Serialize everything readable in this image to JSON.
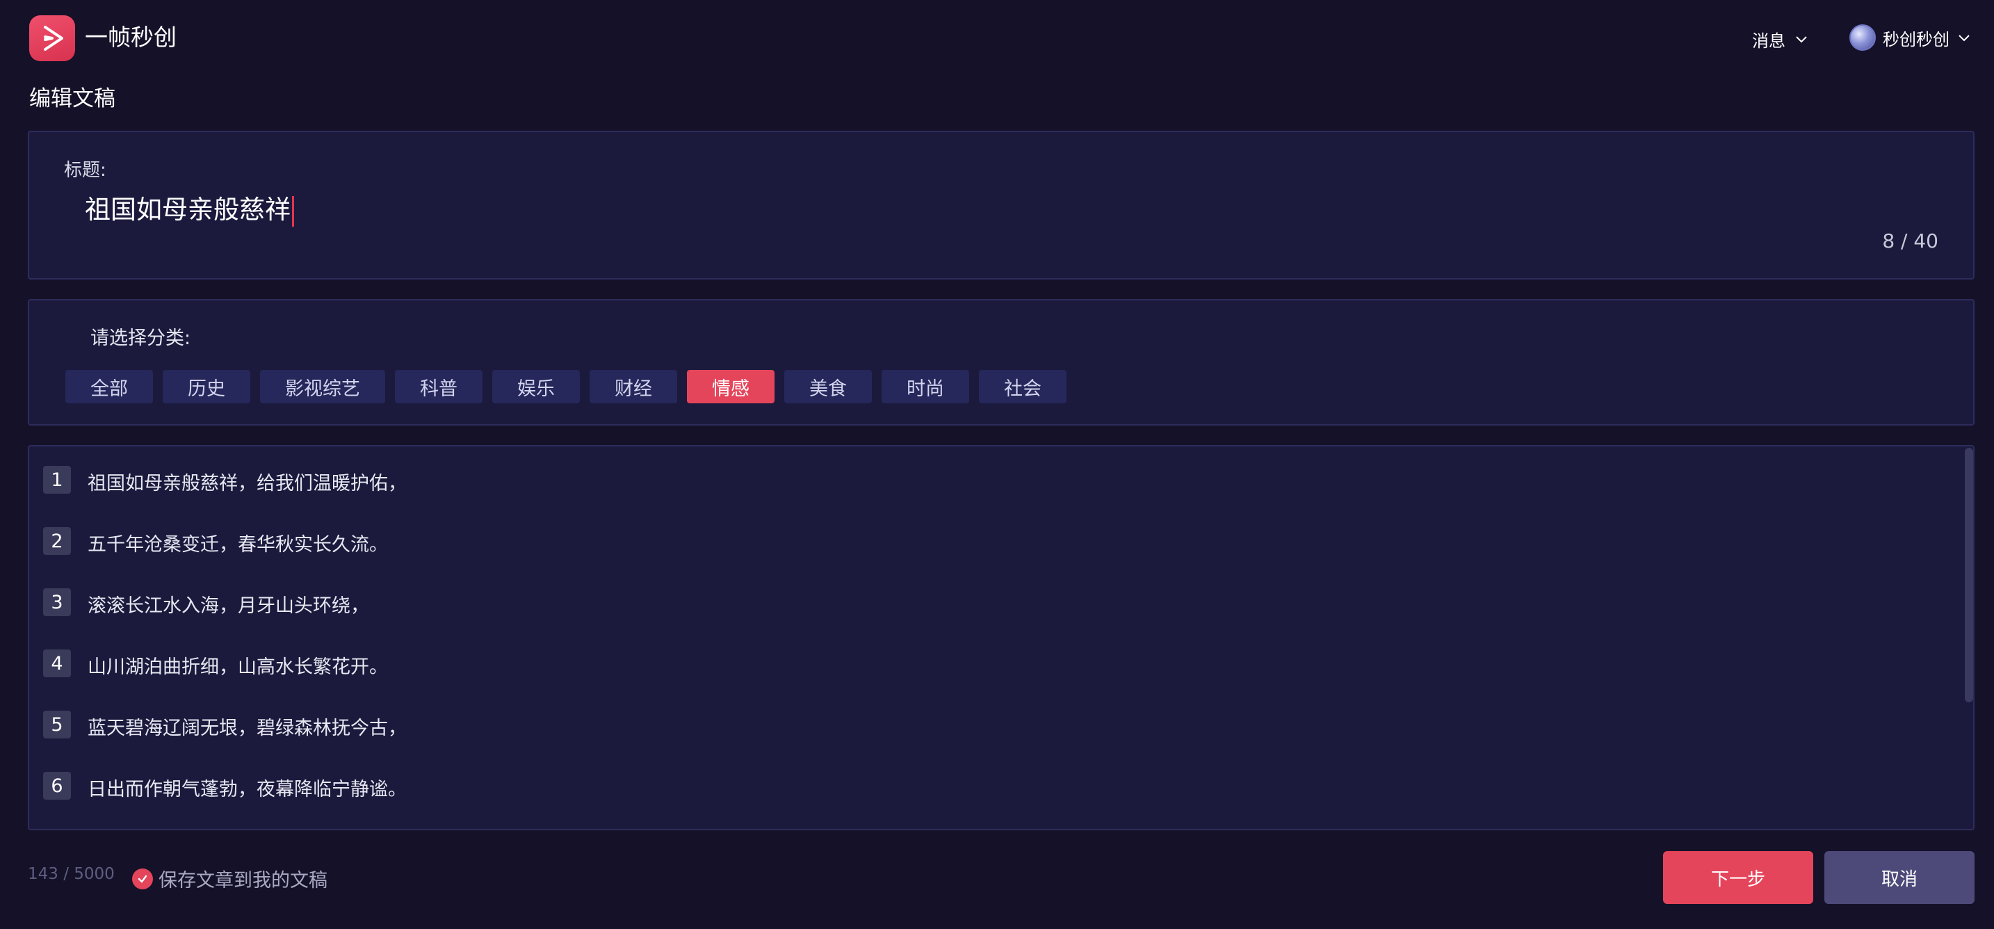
{
  "app": {
    "name": "一帧秒创"
  },
  "header": {
    "messages_label": "消息",
    "user_name": "秒创秒创"
  },
  "page": {
    "title": "编辑文稿"
  },
  "title_section": {
    "label": "标题:",
    "value": "祖国如母亲般慈祥",
    "count": "8 / 40"
  },
  "category_section": {
    "label": "请选择分类:",
    "categories": [
      "全部",
      "历史",
      "影视综艺",
      "科普",
      "娱乐",
      "财经",
      "情感",
      "美食",
      "时尚",
      "社会"
    ],
    "selected": "情感"
  },
  "script_lines": [
    {
      "no": "1",
      "text": "祖国如母亲般慈祥，给我们温暖护佑，"
    },
    {
      "no": "2",
      "text": "五千年沧桑变迁，春华秋实长久流。"
    },
    {
      "no": "3",
      "text": "滚滚长江水入海，月牙山头环绕，"
    },
    {
      "no": "4",
      "text": "山川湖泊曲折细，山高水长繁花开。"
    },
    {
      "no": "5",
      "text": "蓝天碧海辽阔无垠，碧绿森林抚今古，"
    },
    {
      "no": "6",
      "text": "日出而作朝气蓬勃，夜幕降临宁静谧。"
    }
  ],
  "footer": {
    "char_count": "143 / 5000",
    "save_label": "保存文章到我的文稿",
    "save_checked": true,
    "next_label": "下一步",
    "cancel_label": "取消"
  },
  "colors": {
    "background": "#151128",
    "panel": "#1b1a3d",
    "accent": "#e5455b",
    "category_chip": "#26275a",
    "cancel_button": "#4d4a7a"
  },
  "icons": [
    "app-logo-icon",
    "chevron-down-icon",
    "avatar",
    "check-circle-icon"
  ]
}
